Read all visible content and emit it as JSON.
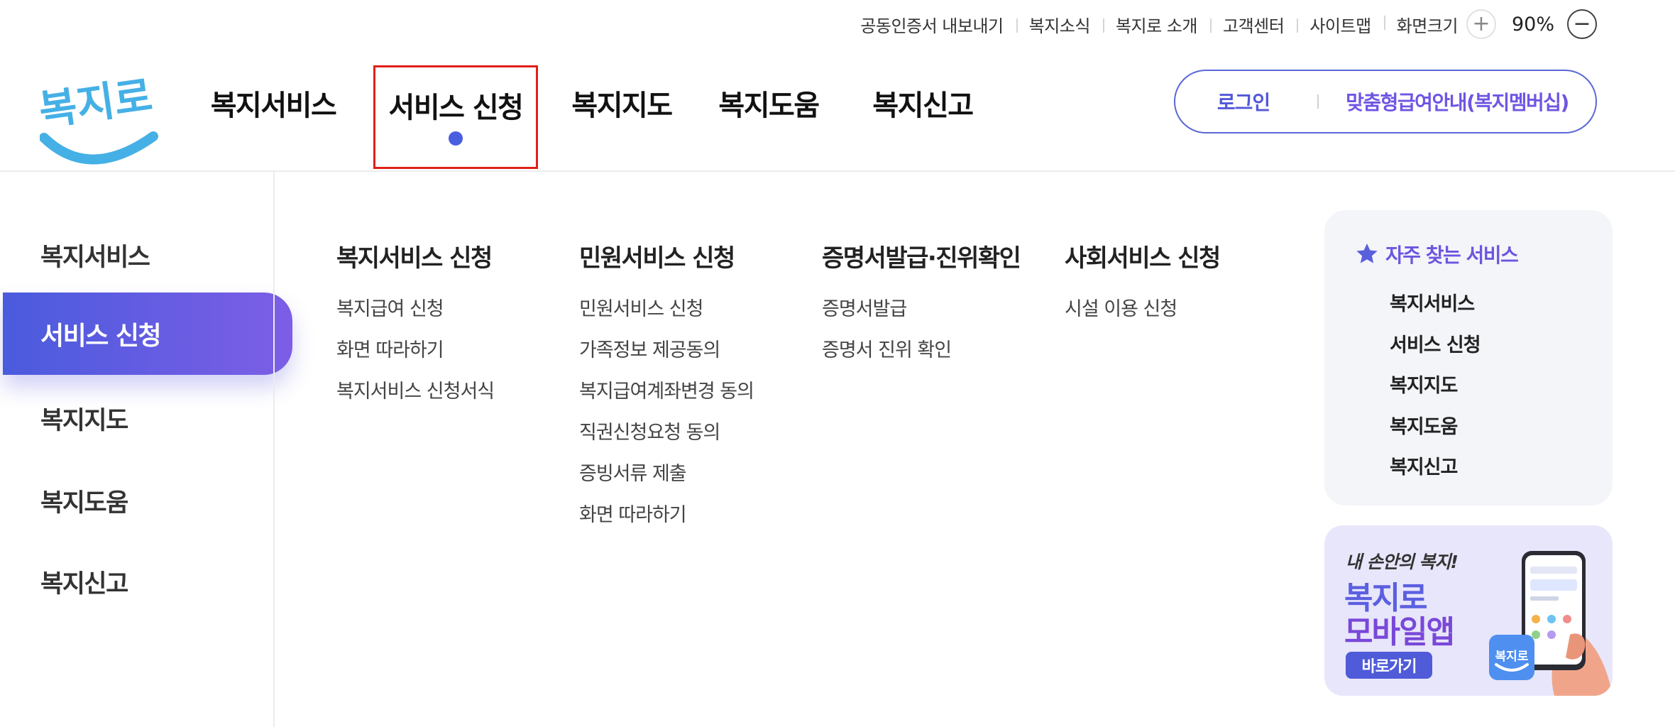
{
  "utility": {
    "links": [
      "공동인증서 내보내기",
      "복지소식",
      "복지로 소개",
      "고객센터",
      "사이트맵"
    ],
    "zoom_label": "화면크기",
    "zoom_plus": "+",
    "zoom_minus": "−",
    "zoom_value": "90%"
  },
  "header": {
    "logo_text": "복지로",
    "gnb": [
      "복지서비스",
      "서비스 신청",
      "복지지도",
      "복지도움",
      "복지신고"
    ],
    "active_index": 1,
    "login": "로그인",
    "membership": "맞춤형급여안내(복지멤버십)"
  },
  "sidebar": {
    "items": [
      "복지서비스",
      "서비스 신청",
      "복지지도",
      "복지도움",
      "복지신고"
    ],
    "active_index": 1
  },
  "menu": {
    "columns": [
      {
        "title": "복지서비스 신청",
        "links": [
          "복지급여 신청",
          "화면 따라하기",
          "복지서비스 신청서식"
        ]
      },
      {
        "title": "민원서비스 신청",
        "links": [
          "민원서비스 신청",
          "가족정보 제공동의",
          "복지급여계좌변경 동의",
          "직권신청요청 동의",
          "증빙서류 제출",
          "화면 따라하기"
        ]
      },
      {
        "title": "증명서발급·진위확인",
        "links": [
          "증명서발급",
          "증명서 진위 확인"
        ]
      },
      {
        "title": "사회서비스 신청",
        "links": [
          "시설 이용 신청"
        ]
      }
    ]
  },
  "frequent": {
    "icon": "star-icon",
    "title": "자주 찾는 서비스",
    "items": [
      "복지서비스",
      "서비스 신청",
      "복지지도",
      "복지도움",
      "복지신고"
    ]
  },
  "app_banner": {
    "tagline": "내 손안의 복지!",
    "title_line1": "복지로",
    "title_line2": "모바일앱",
    "button": "바로가기",
    "badge_text": "복지로"
  },
  "colors": {
    "accent": "#5a5fdc",
    "accent_purple": "#6f55e3",
    "highlight_box": "#e0201b",
    "logo_blue": "#45b0e6"
  }
}
